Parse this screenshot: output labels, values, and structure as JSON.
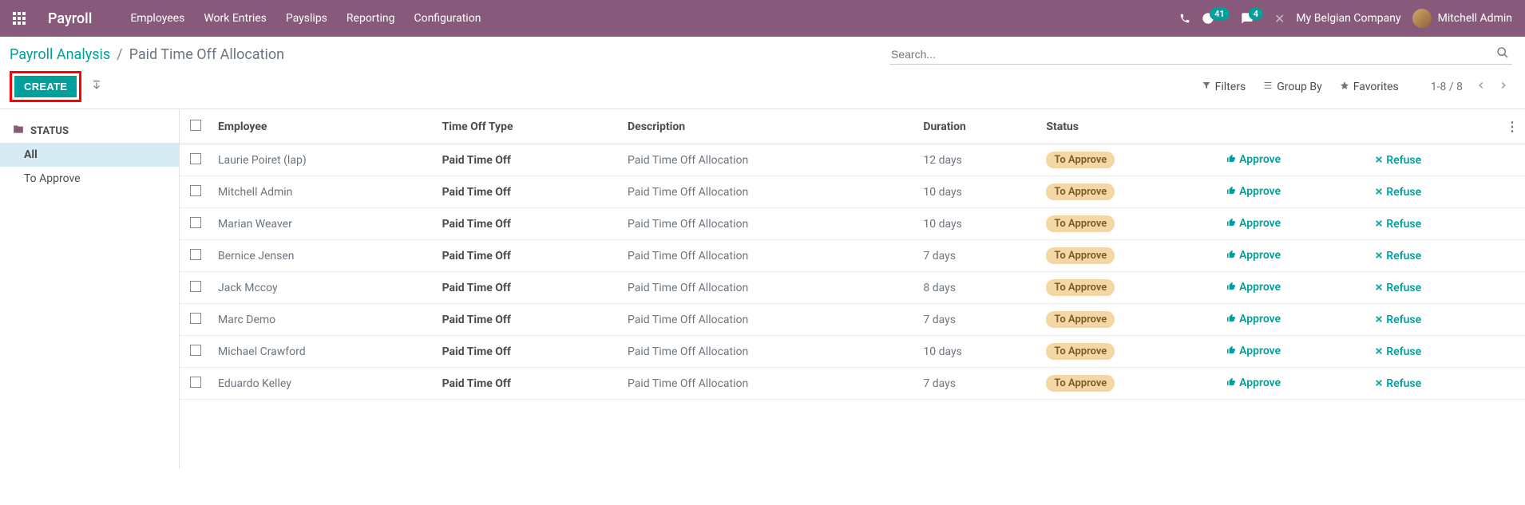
{
  "navbar": {
    "brand": "Payroll",
    "menu": [
      "Employees",
      "Work Entries",
      "Payslips",
      "Reporting",
      "Configuration"
    ],
    "clock_badge": "41",
    "chat_badge": "4",
    "company": "My Belgian Company",
    "user": "Mitchell Admin"
  },
  "breadcrumb": {
    "parent": "Payroll Analysis",
    "current": "Paid Time Off Allocation"
  },
  "search": {
    "placeholder": "Search..."
  },
  "buttons": {
    "create": "CREATE"
  },
  "search_options": {
    "filters": "Filters",
    "groupby": "Group By",
    "favorites": "Favorites"
  },
  "pager": {
    "range": "1-8",
    "total": "8"
  },
  "sidebar": {
    "header": "STATUS",
    "items": [
      {
        "label": "All",
        "active": true
      },
      {
        "label": "To Approve",
        "active": false
      }
    ]
  },
  "table": {
    "headers": {
      "employee": "Employee",
      "tot": "Time Off Type",
      "desc": "Description",
      "duration": "Duration",
      "status": "Status"
    },
    "action_approve": "Approve",
    "action_refuse": "Refuse",
    "rows": [
      {
        "employee": "Laurie Poiret (lap)",
        "tot": "Paid Time Off",
        "desc": "Paid Time Off Allocation",
        "duration": "12 days",
        "status": "To Approve"
      },
      {
        "employee": "Mitchell Admin",
        "tot": "Paid Time Off",
        "desc": "Paid Time Off Allocation",
        "duration": "10 days",
        "status": "To Approve"
      },
      {
        "employee": "Marian Weaver",
        "tot": "Paid Time Off",
        "desc": "Paid Time Off Allocation",
        "duration": "10 days",
        "status": "To Approve"
      },
      {
        "employee": "Bernice Jensen",
        "tot": "Paid Time Off",
        "desc": "Paid Time Off Allocation",
        "duration": "7 days",
        "status": "To Approve"
      },
      {
        "employee": "Jack Mccoy",
        "tot": "Paid Time Off",
        "desc": "Paid Time Off Allocation",
        "duration": "8 days",
        "status": "To Approve"
      },
      {
        "employee": "Marc Demo",
        "tot": "Paid Time Off",
        "desc": "Paid Time Off Allocation",
        "duration": "7 days",
        "status": "To Approve"
      },
      {
        "employee": "Michael Crawford",
        "tot": "Paid Time Off",
        "desc": "Paid Time Off Allocation",
        "duration": "10 days",
        "status": "To Approve"
      },
      {
        "employee": "Eduardo Kelley",
        "tot": "Paid Time Off",
        "desc": "Paid Time Off Allocation",
        "duration": "7 days",
        "status": "To Approve"
      }
    ]
  }
}
